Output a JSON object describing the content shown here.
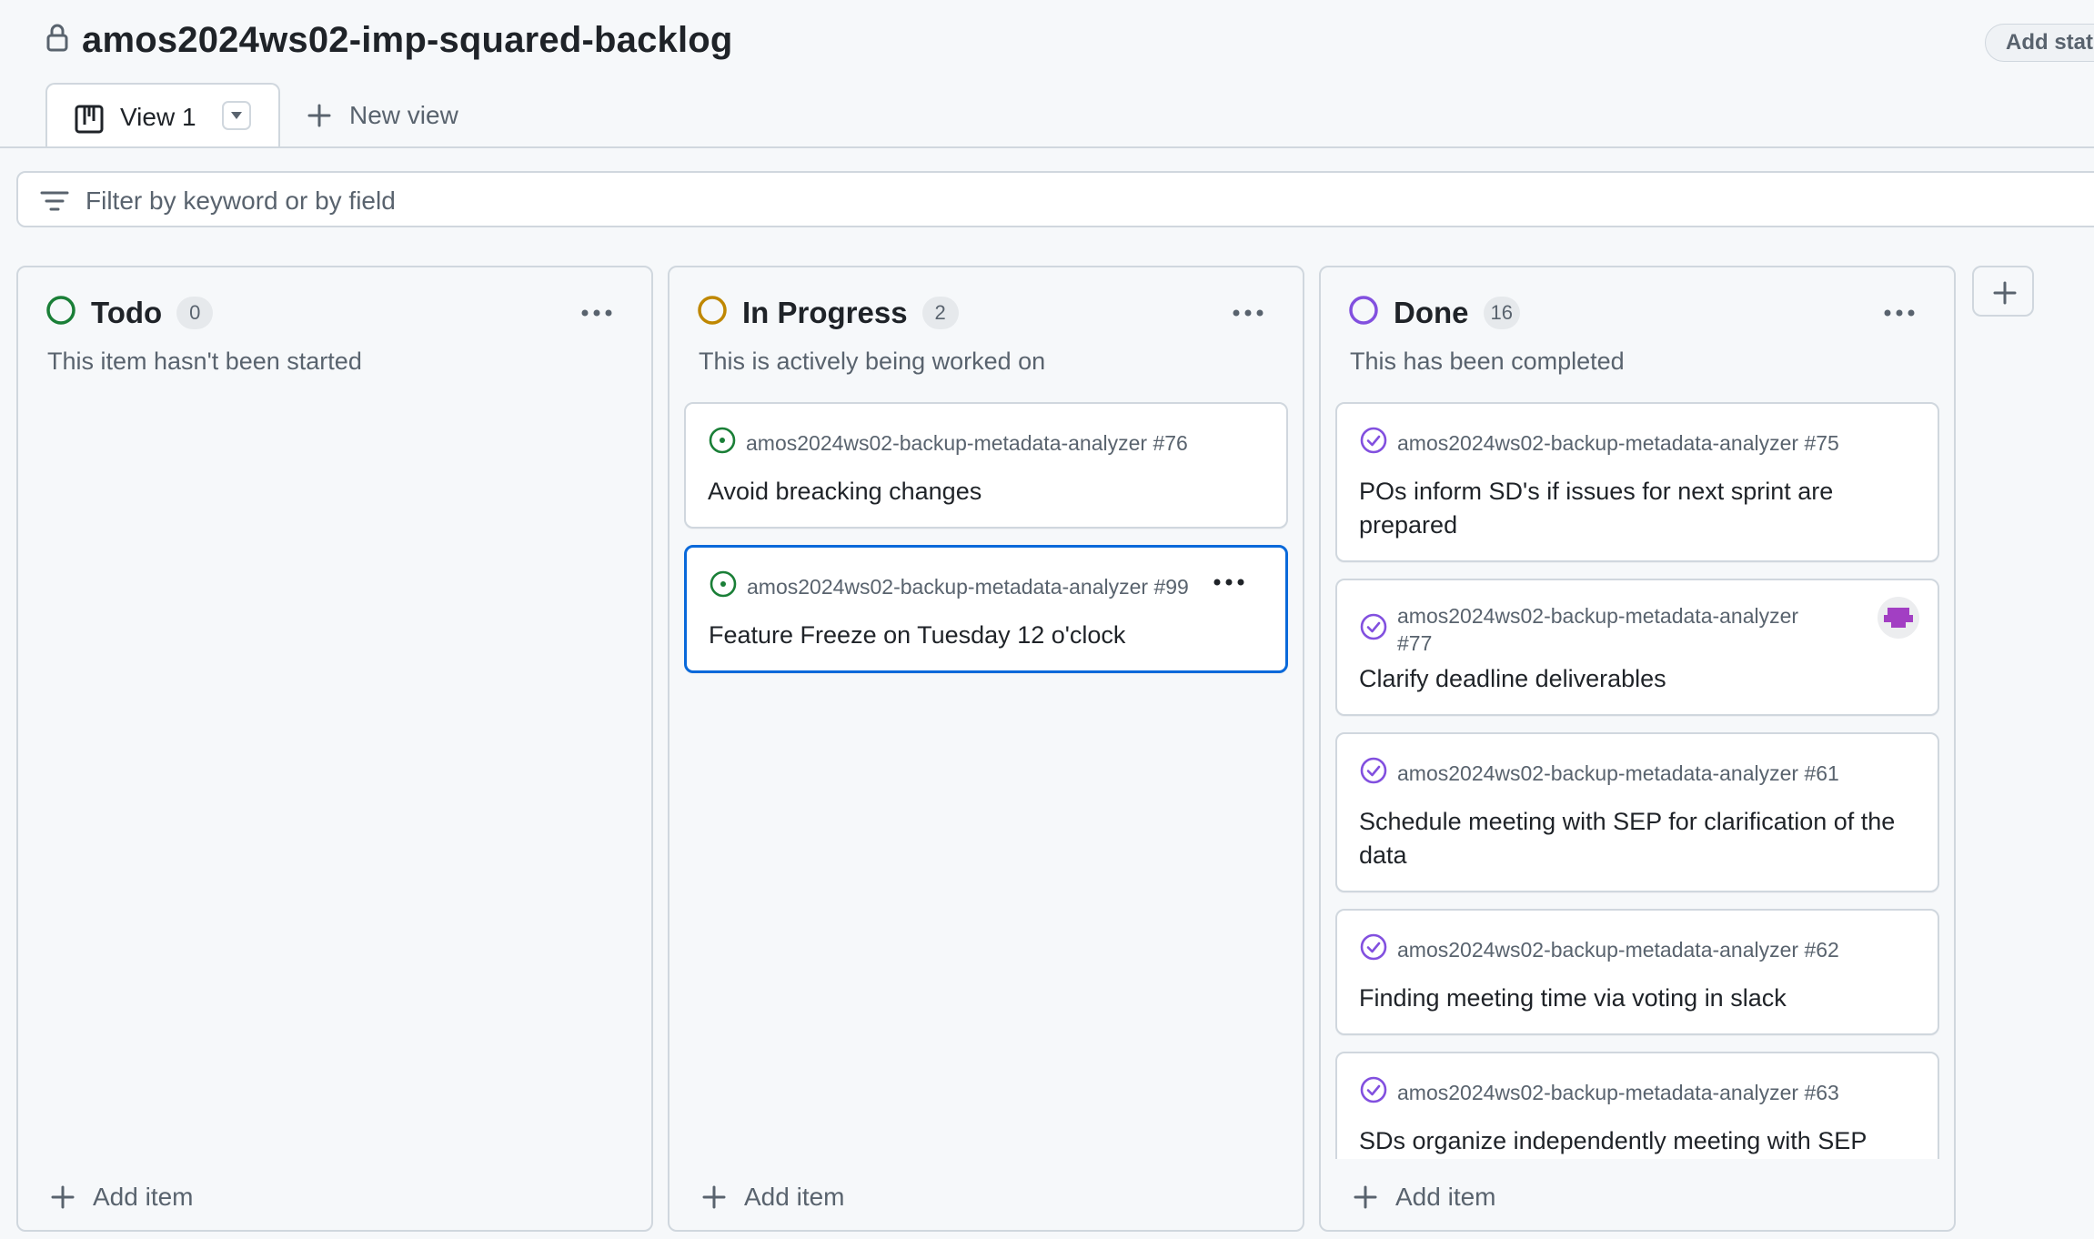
{
  "header": {
    "title": "amos2024ws02-imp-squared-backlog",
    "status_button": "Add statu"
  },
  "tabs": {
    "active_label": "View 1",
    "new_view_label": "New view"
  },
  "filter": {
    "placeholder": "Filter by keyword or by field"
  },
  "columns": [
    {
      "name": "Todo",
      "count": "0",
      "description": "This item hasn't been started",
      "status_color": "#1a7f37",
      "add_item_label": "Add item",
      "cards": []
    },
    {
      "name": "In Progress",
      "count": "2",
      "description": "This is actively being worked on",
      "status_color": "#bf8700",
      "add_item_label": "Add item",
      "cards": [
        {
          "ref": "amos2024ws02-backup-metadata-analyzer #76",
          "title": "Avoid breacking changes"
        },
        {
          "ref": "amos2024ws02-backup-metadata-analyzer #99",
          "title": "Feature Freeze on Tuesday 12 o'clock"
        }
      ]
    },
    {
      "name": "Done",
      "count": "16",
      "description": "This has been completed",
      "status_color": "#8250df",
      "add_item_label": "Add item",
      "cards": [
        {
          "ref": "amos2024ws02-backup-metadata-analyzer #75",
          "title": "POs inform SD's if issues for next sprint are prepared"
        },
        {
          "ref": "amos2024ws02-backup-metadata-analyzer #77",
          "title": "Clarify deadline deliverables"
        },
        {
          "ref": "amos2024ws02-backup-metadata-analyzer #61",
          "title": "Schedule meeting with SEP for clarification of the data"
        },
        {
          "ref": "amos2024ws02-backup-metadata-analyzer #62",
          "title": "Finding meeting time via voting in slack"
        },
        {
          "ref": "amos2024ws02-backup-metadata-analyzer #63",
          "title": "SDs organize independently meeting with SEP about dev topics."
        }
      ]
    }
  ],
  "colors": {
    "open_issue": "#1a7f37",
    "closed_issue": "#8250df",
    "selection": "#0969da"
  }
}
